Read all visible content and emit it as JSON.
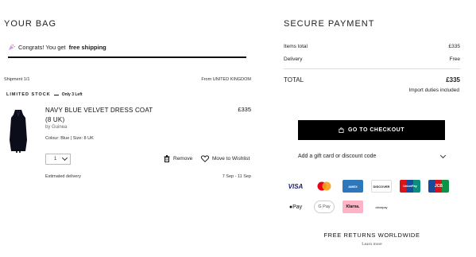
{
  "bag": {
    "title": "YOUR BAG",
    "shipping_msg_prefix": "Congrats! You get ",
    "shipping_msg_bold": "free shipping",
    "shipping_progress": 1.0,
    "shipment_label": "Shipment 1/1",
    "ship_from": "From UNITED KINGDOM",
    "stock_tag": "LIMITED STOCK",
    "stock_left": "Only 3 Left",
    "item": {
      "name": "NAVY BLUE VELVET DRESS COAT (8 UK)",
      "brand": "by Guinea",
      "spec": "Colour: Blue | Size: 8 UK",
      "price": "£335",
      "quantity": "1",
      "remove_label": "Remove",
      "wishlist_label": "Move to Wishlist",
      "est_delivery_label": "Estimated delivery",
      "est_delivery_date": "7 Sep - 11 Sep"
    }
  },
  "payment": {
    "title": "SECURE PAYMENT",
    "items_total_label": "Items total",
    "items_total_value": "£335",
    "delivery_label": "Delivery",
    "delivery_value": "Free",
    "total_label": "TOTAL",
    "total_value": "£335",
    "duties": "Import duties included",
    "checkout_label": "GO TO CHECKOUT",
    "gift_label": "Add a gift card or discount code",
    "methods_row1": [
      "VISA",
      "Mastercard",
      "AMEX",
      "DISCOVER",
      "UnionPay",
      "JCB"
    ],
    "methods_row2": [
      "Pay",
      "G Pay",
      "Klarna.",
      "clearpay"
    ],
    "free_returns": "FREE RETURNS WORLDWIDE",
    "learn_more": "Learn more"
  },
  "colors": {
    "accent": "#000000",
    "klarna": "#ffb3c7",
    "amex": "#2e77bb",
    "unionpay_red": "#d7141a",
    "jcb_green": "#0e9246"
  }
}
